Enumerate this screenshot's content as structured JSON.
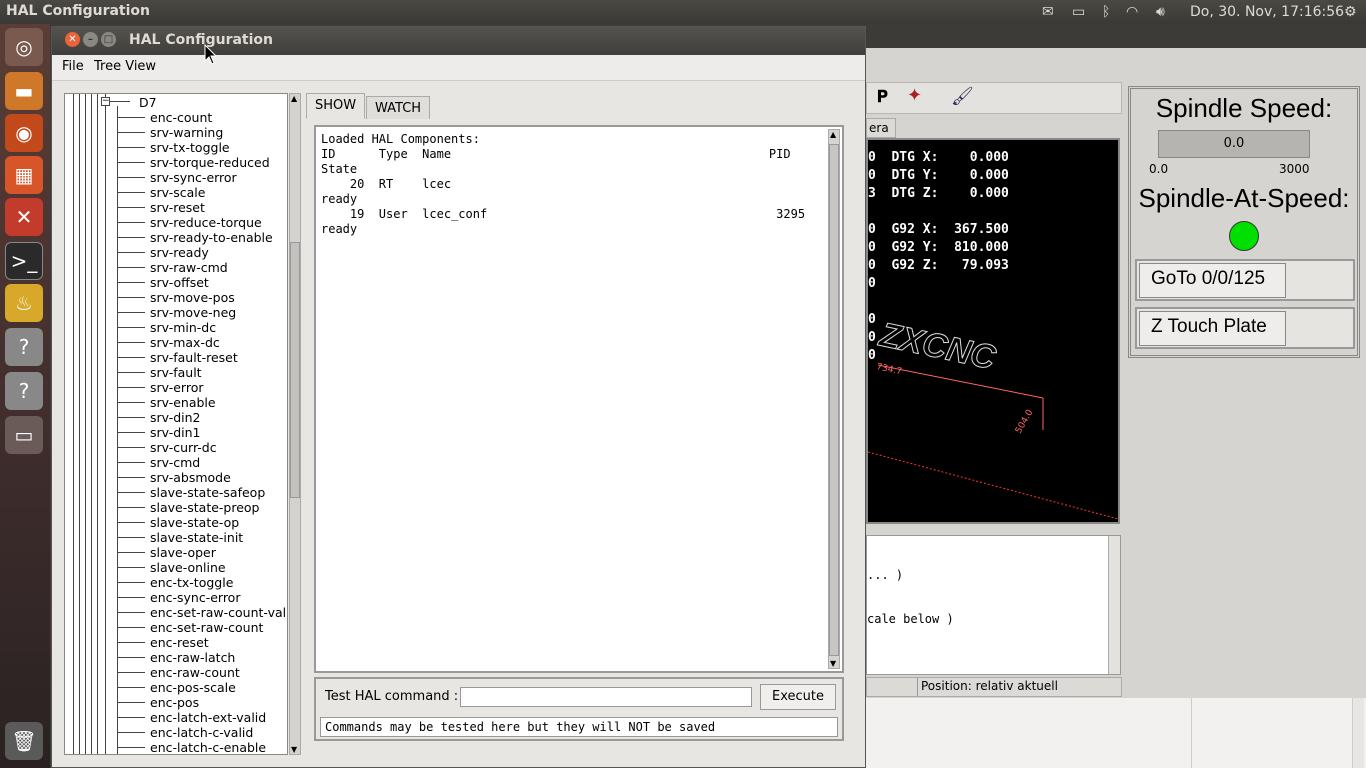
{
  "topbar": {
    "app_title": "HAL Configuration",
    "clock": "Do, 30. Nov, 17:16:56"
  },
  "window": {
    "title": "HAL Configuration",
    "menu": [
      "File",
      "Tree View"
    ]
  },
  "tree": {
    "parent": "D7",
    "items": [
      "enc-count",
      "srv-warning",
      "srv-tx-toggle",
      "srv-torque-reduced",
      "srv-sync-error",
      "srv-scale",
      "srv-reset",
      "srv-reduce-torque",
      "srv-ready-to-enable",
      "srv-ready",
      "srv-raw-cmd",
      "srv-offset",
      "srv-move-pos",
      "srv-move-neg",
      "srv-min-dc",
      "srv-max-dc",
      "srv-fault-reset",
      "srv-fault",
      "srv-error",
      "srv-enable",
      "srv-din2",
      "srv-din1",
      "srv-curr-dc",
      "srv-cmd",
      "srv-absmode",
      "slave-state-safeop",
      "slave-state-preop",
      "slave-state-op",
      "slave-state-init",
      "slave-oper",
      "slave-online",
      "enc-tx-toggle",
      "enc-sync-error",
      "enc-set-raw-count-val",
      "enc-set-raw-count",
      "enc-reset",
      "enc-raw-latch",
      "enc-raw-count",
      "enc-pos-scale",
      "enc-pos",
      "enc-latch-ext-valid",
      "enc-latch-c-valid",
      "enc-latch-c-enable"
    ]
  },
  "tabs": [
    "SHOW",
    "WATCH"
  ],
  "show": {
    "lines": [
      "Loaded HAL Components:",
      "ID      Type  Name                                            PID",
      "State",
      "    20  RT    lcec",
      "ready",
      "    19  User  lcec_conf                                        3295",
      "ready"
    ]
  },
  "command": {
    "label": "Test HAL command :",
    "input_value": "",
    "execute_label": "Execute",
    "info": "Commands may be tested here but they will NOT be saved"
  },
  "background": {
    "tab_fragment": "era",
    "dro": [
      "0  DTG X:    0.000",
      "0  DTG Y:    0.000",
      "3  DTG Z:    0.000",
      "0  G92 X:  367.500",
      "0  G92 Y:  810.000",
      "0  G92 Z:   79.093",
      "0",
      "0",
      "0",
      "0"
    ],
    "logo_text": "ZXCNC",
    "dim1": "734.7",
    "dim2": "504.0",
    "mdi_lines": [
      "... )",
      "cale below )"
    ],
    "status_text": "Position: relativ aktuell",
    "spindle_speed_title": "Spindle Speed:",
    "spindle_speed_value": "0.0",
    "scale_min": "0.0",
    "scale_max": "3000",
    "spindle_at_speed_title": "Spindle-At-Speed:",
    "goto_label": "GoTo 0/0/125",
    "ztouch_label": "Z Touch Plate",
    "led_color": "#00e000"
  }
}
